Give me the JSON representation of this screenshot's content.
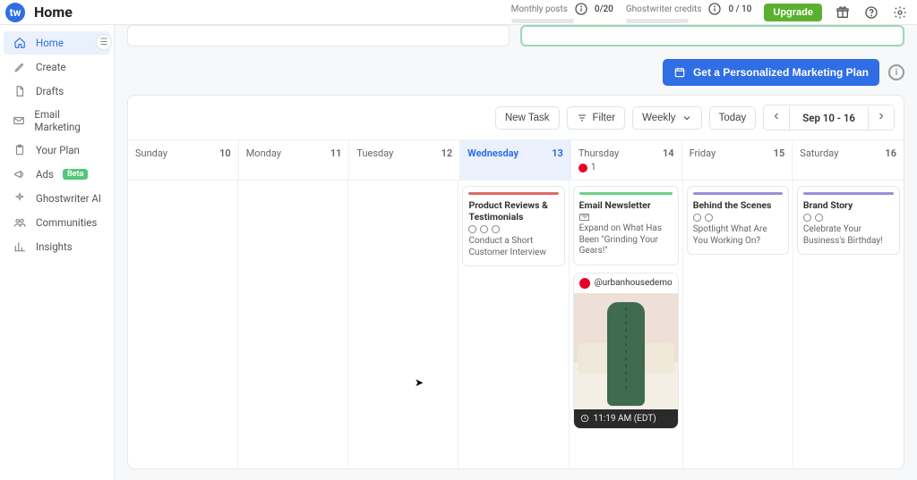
{
  "header": {
    "page_title": "Home",
    "logo_text": "tw",
    "metrics": {
      "monthly_posts": {
        "label": "Monthly posts",
        "count": "0/20"
      },
      "ghostwriter_credits": {
        "label": "Ghostwriter credits",
        "count": "0 / 10"
      }
    },
    "upgrade_label": "Upgrade"
  },
  "sidebar": {
    "items": [
      {
        "label": "Home",
        "icon": "home",
        "active": true,
        "collapse": true
      },
      {
        "label": "Create",
        "icon": "pencil"
      },
      {
        "label": "Drafts",
        "icon": "doc"
      },
      {
        "label": "Email Marketing",
        "icon": "mail"
      },
      {
        "label": "Your Plan",
        "icon": "clipboard"
      },
      {
        "label": "Ads",
        "icon": "megaphone",
        "badge": "Beta"
      },
      {
        "label": "Ghostwriter AI",
        "icon": "sparkle"
      },
      {
        "label": "Communities",
        "icon": "people"
      },
      {
        "label": "Insights",
        "icon": "chart"
      }
    ]
  },
  "plan_bar": {
    "button_label": "Get a Personalized Marketing Plan"
  },
  "toolbar": {
    "new_task": "New Task",
    "filter": "Filter",
    "view": "Weekly",
    "today": "Today",
    "date_range": "Sep 10 - 16"
  },
  "calendar": {
    "days": [
      {
        "name": "Sunday",
        "num": "10",
        "today": false
      },
      {
        "name": "Monday",
        "num": "11",
        "today": false
      },
      {
        "name": "Tuesday",
        "num": "12",
        "today": false
      },
      {
        "name": "Wednesday",
        "num": "13",
        "today": true
      },
      {
        "name": "Thursday",
        "num": "14",
        "today": false,
        "pin_count": "1"
      },
      {
        "name": "Friday",
        "num": "15",
        "today": false
      },
      {
        "name": "Saturday",
        "num": "16",
        "today": false
      }
    ],
    "cards": {
      "wednesday": {
        "title": "Product Reviews & Testimonials",
        "desc": "Conduct a Short Customer Interview",
        "accent": "red"
      },
      "thursday": {
        "title": "Email Newsletter",
        "desc": "Expand on What Has Been \"Grinding Your Gears!\"",
        "accent": "green"
      },
      "friday": {
        "title": "Behind the Scenes",
        "desc": "Spotlight What Are You Working On?",
        "accent": "purple"
      },
      "saturday": {
        "title": "Brand Story",
        "desc": "Celebrate Your Business's Birthday!",
        "accent": "purple"
      }
    },
    "post": {
      "handle": "@urbanhousedemo",
      "time_label": "11:19 AM (EDT)"
    }
  }
}
